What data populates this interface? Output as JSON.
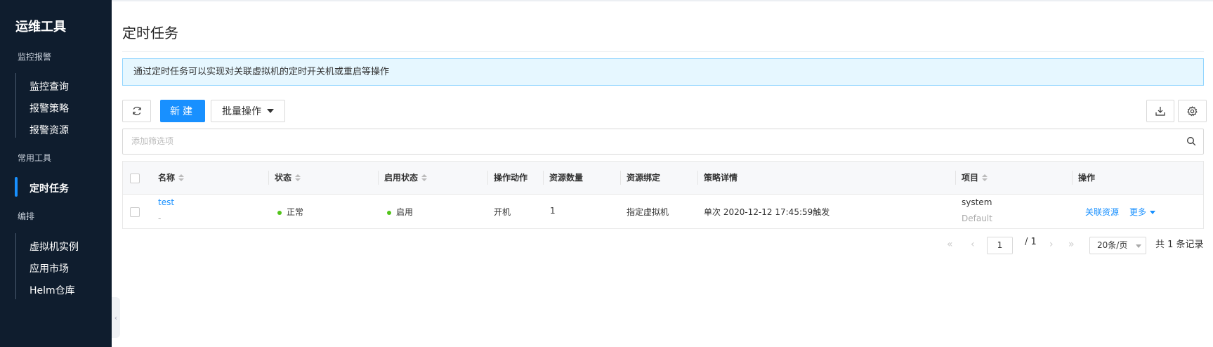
{
  "sidebar": {
    "title": "运维工具",
    "groups": [
      {
        "title": "监控报警",
        "items": [
          "监控查询",
          "报警策略",
          "报警资源"
        ]
      },
      {
        "title": "常用工具",
        "items": [
          "定时任务"
        ]
      },
      {
        "title": "编排",
        "items": [
          "虚拟机实例",
          "应用市场",
          "Helm仓库"
        ]
      }
    ],
    "active_item": "定时任务"
  },
  "page": {
    "title": "定时任务",
    "notice": "通过定时任务可以实现对关联虚拟机的定时开关机或重启等操作"
  },
  "toolbar": {
    "new_label": "新建",
    "batch_label": "批量操作"
  },
  "filter": {
    "placeholder": "添加筛选项"
  },
  "table": {
    "columns": [
      "名称",
      "状态",
      "启用状态",
      "操作动作",
      "资源数量",
      "资源绑定",
      "策略详情",
      "项目",
      "操作"
    ],
    "rows": [
      {
        "name": "test",
        "desc": "-",
        "status": "正常",
        "enabled": "启用",
        "action": "开机",
        "resource_count": "1",
        "binding": "指定虚拟机",
        "detail": "单次 2020-12-12 17:45:59触发",
        "project": "system",
        "domain": "Default",
        "op_link": "关联资源",
        "op_more": "更多"
      }
    ]
  },
  "pagination": {
    "current_page": "1",
    "total_pages": "/ 1",
    "page_size": "20条/页",
    "total": "共 1 条记录"
  },
  "colors": {
    "accent": "#1890ff",
    "sidebar_bg": "#0f1d2e",
    "status_ok": "#52c41a"
  }
}
